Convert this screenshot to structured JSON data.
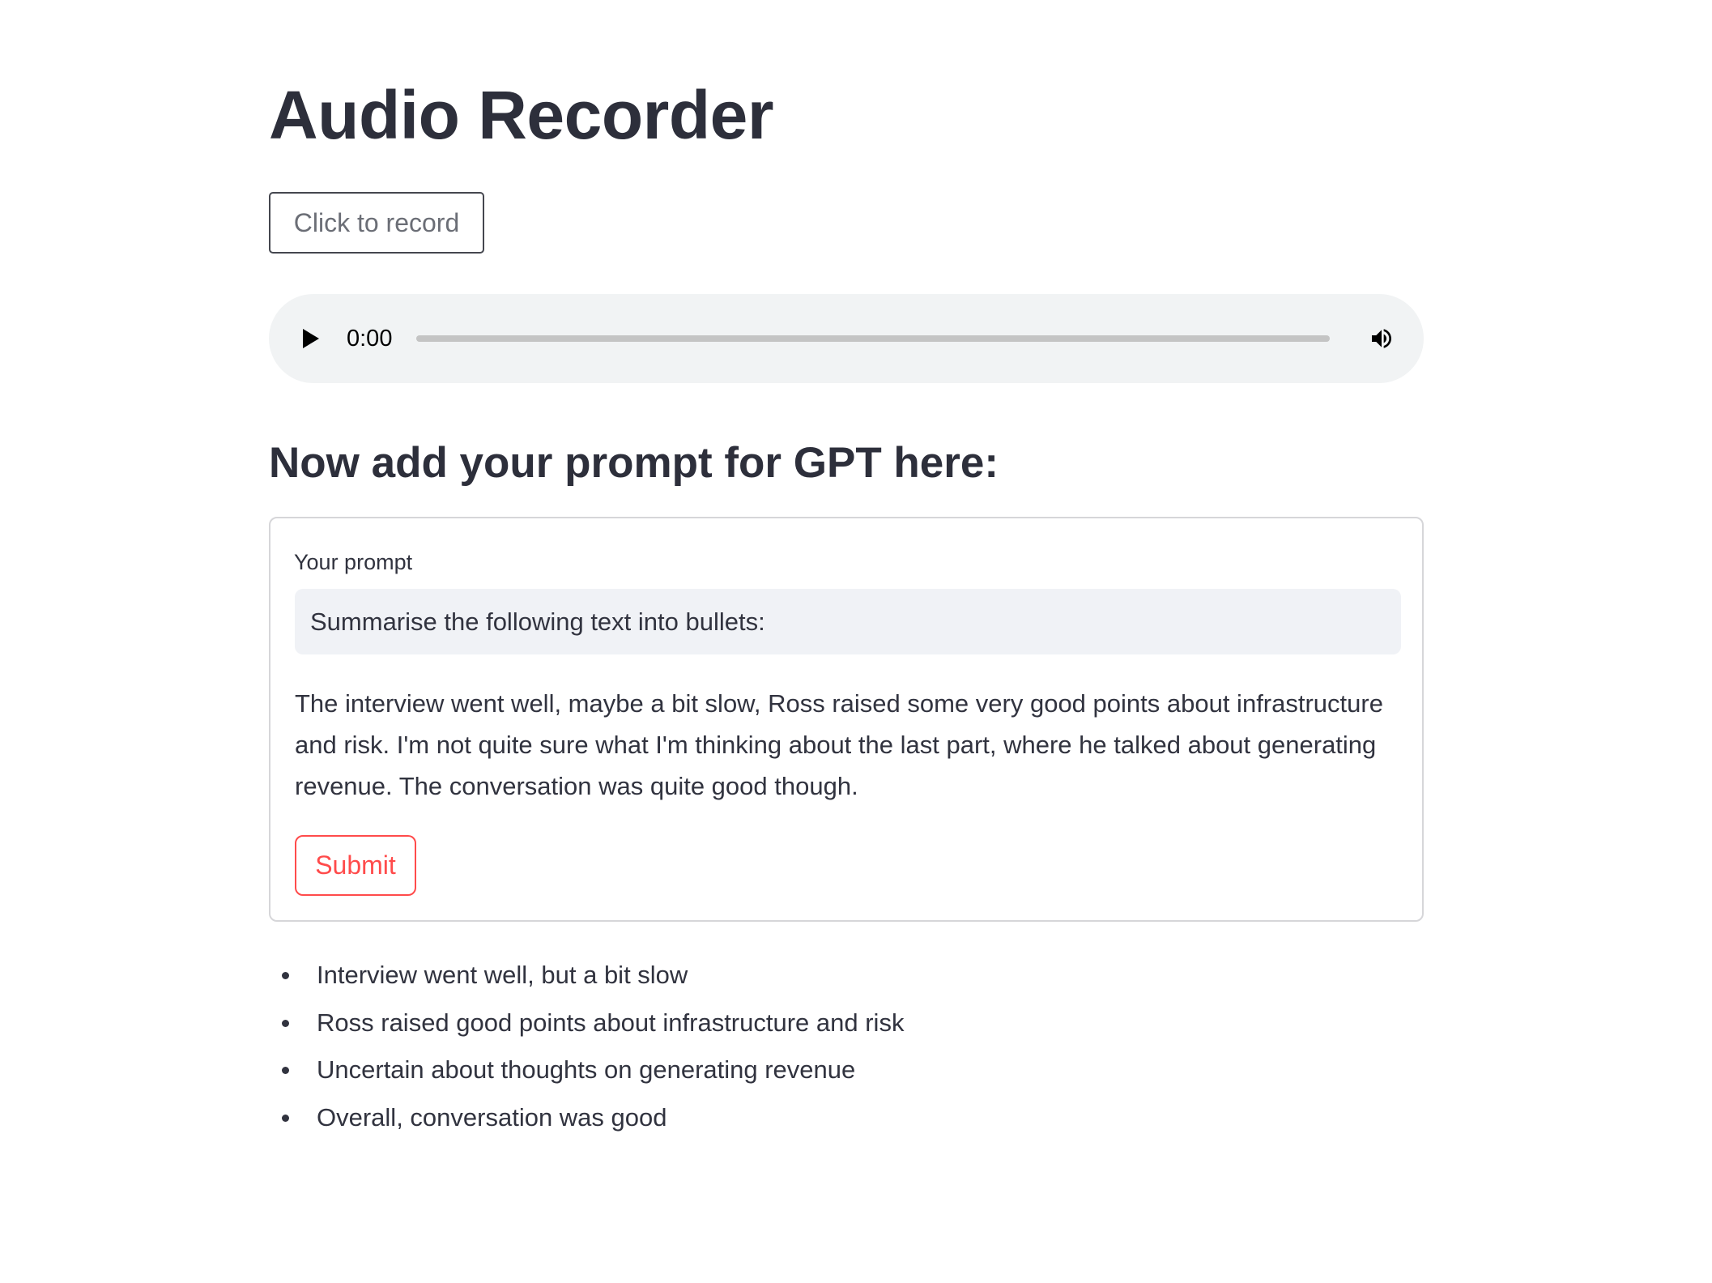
{
  "page": {
    "title": "Audio Recorder"
  },
  "recorder": {
    "button_label": "Click to record"
  },
  "audio_player": {
    "time": "0:00",
    "progress": 0
  },
  "prompt_section": {
    "heading": "Now add your prompt for GPT here:",
    "label": "Your prompt",
    "input_value": "Summarise the following text into bullets:",
    "body_text": "The interview went well, maybe a bit slow, Ross raised some very good points about infrastructure and risk. I'm not quite sure what I'm thinking about the last part, where he talked about generating revenue. The conversation was quite good though.",
    "submit_label": "Submit"
  },
  "results": {
    "bullets": [
      "Interview went well, but a bit slow",
      "Ross raised good points about infrastructure and risk",
      "Uncertain about thoughts on generating revenue",
      "Overall, conversation was good"
    ]
  },
  "colors": {
    "accent": "#ff4b4b",
    "text": "#31333f",
    "input_background": "#f0f2f6",
    "player_background": "#f1f3f4"
  },
  "icons": {
    "play": "play-icon",
    "volume": "volume-icon"
  }
}
